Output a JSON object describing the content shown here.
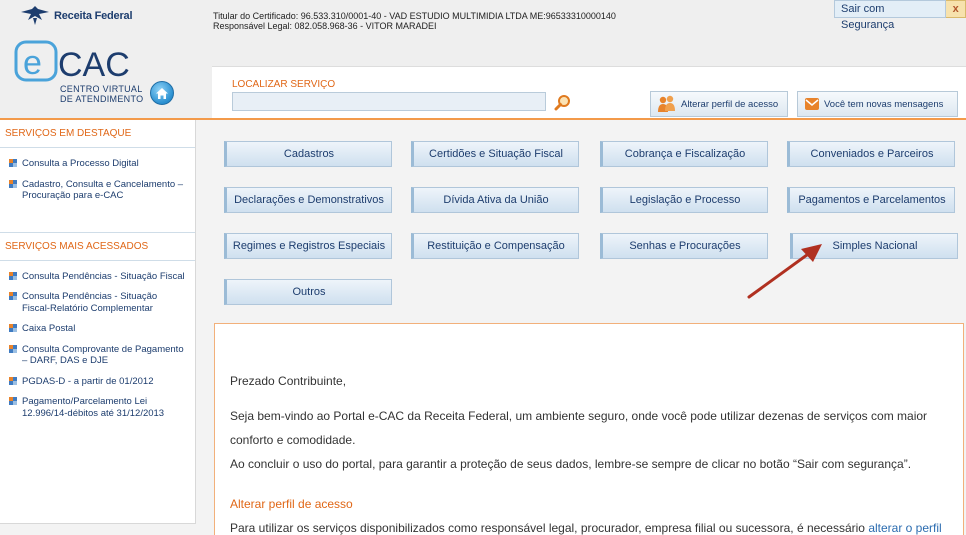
{
  "header": {
    "brand": "Receita Federal",
    "ecac_logo_text": "CAC",
    "ecac_sub_line1": "CENTRO VIRTUAL",
    "ecac_sub_line2": "DE ATENDIMENTO",
    "cert_line1": "Titular do Certificado: 96.533.310/0001-40 - VAD ESTUDIO MULTIMIDIA LTDA ME:96533310000140",
    "cert_line2": "Responsável Legal: 082.058.968-36 - VITOR MARADEI",
    "logout_label": "Sair com Segurança",
    "logout_x": "x",
    "search_label": "LOCALIZAR SERVIÇO",
    "search_value": "",
    "btn_perfil": "Alterar perfil de acesso",
    "btn_msgs": "Você tem novas mensagens"
  },
  "sidebar": {
    "section1_title": "SERVIÇOS EM DESTAQUE",
    "section1_items": [
      "Consulta a Processo Digital",
      "Cadastro, Consulta e Cancelamento – Procuração para e-CAC"
    ],
    "section2_title": "SERVIÇOS MAIS ACESSADOS",
    "section2_items": [
      "Consulta Pendências - Situação Fiscal",
      "Consulta Pendências - Situação Fiscal-Relatório Complementar",
      "Caixa Postal",
      "Consulta Comprovante de Pagamento – DARF, DAS e DJE",
      "PGDAS-D - a partir de 01/2012",
      "Pagamento/Parcelamento Lei 12.996/14-débitos até 31/12/2013"
    ]
  },
  "services": [
    "Cadastros",
    "Certidões e Situação Fiscal",
    "Cobrança e Fiscalização",
    "Conveniados e Parceiros",
    "Declarações e Demonstrativos",
    "Dívida Ativa da União",
    "Legislação e Processo",
    "Pagamentos e Parcelamentos",
    "Regimes e Registros Especiais",
    "Restituição e Compensação",
    "Senhas e Procurações",
    "Simples Nacional",
    "Outros"
  ],
  "welcome": {
    "greeting": "Prezado Contribuinte,",
    "p1": "Seja bem-vindo ao Portal e-CAC da Receita Federal, um ambiente seguro, onde você pode utilizar dezenas de serviços com maior conforto e comodidade.",
    "p2": "Ao concluir o uso do portal, para garantir a proteção de seus dados, lembre-se sempre de clicar no botão “Sair com segurança”.",
    "alt_title": "Alterar perfil de acesso",
    "p3_text": "Para utilizar os serviços disponibilizados como responsável legal, procurador, empresa filial ou sucessora, é necessário ",
    "p3_link": "alterar o perfil"
  },
  "colors": {
    "accent_orange": "#e06717",
    "link_blue": "#1d3d6e",
    "annotation_arrow": "#b03020"
  }
}
